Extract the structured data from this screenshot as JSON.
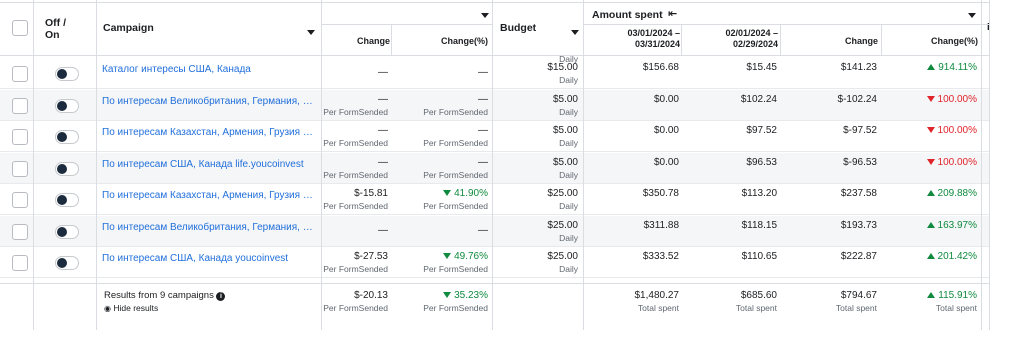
{
  "header": {
    "off_on": "Off /\nOn",
    "off_on_line1": "Off /",
    "off_on_line2": "On",
    "campaign": "Campaign",
    "budget": "Budget",
    "amount_spent": "Amount spent",
    "next_col_clip": "Er",
    "change": "Change",
    "change_pct": "Change(%)",
    "period_current": "03/01/2024 –\n03/31/2024",
    "period_current_l1": "03/01/2024 –",
    "period_current_l2": "03/31/2024",
    "period_prev_l1": "02/01/2024 –",
    "period_prev_l2": "02/29/2024",
    "daily_top": "Daily"
  },
  "rows": [
    {
      "name": "Каталог интересы США, Канада",
      "res_change": "—",
      "res_change_sub": "",
      "res_pct": "—",
      "res_pct_sub": "",
      "res_pct_dir": "",
      "budget": "$15.00",
      "budget_sub": "Daily",
      "spent_cur": "$156.68",
      "spent_prev": "$15.45",
      "spent_change": "$141.23",
      "spent_pct": "914.11%",
      "spent_dir": "up"
    },
    {
      "name": "По интересам Великобритания, Германия, Ис…",
      "res_change": "—",
      "res_change_sub": "Per FormSended",
      "res_pct": "—",
      "res_pct_sub": "Per FormSended",
      "res_pct_dir": "",
      "budget": "$5.00",
      "budget_sub": "Daily",
      "spent_cur": "$0.00",
      "spent_prev": "$102.24",
      "spent_change": "$-102.24",
      "spent_pct": "100.00%",
      "spent_dir": "down"
    },
    {
      "name": "По интересам Казахстан, Армения, Грузия life…",
      "res_change": "—",
      "res_change_sub": "Per FormSended",
      "res_pct": "—",
      "res_pct_sub": "Per FormSended",
      "res_pct_dir": "",
      "budget": "$5.00",
      "budget_sub": "Daily",
      "spent_cur": "$0.00",
      "spent_prev": "$97.52",
      "spent_change": "$-97.52",
      "spent_pct": "100.00%",
      "spent_dir": "down"
    },
    {
      "name": "По интересам США, Канада life.youcoinvest",
      "res_change": "—",
      "res_change_sub": "Per FormSended",
      "res_pct": "—",
      "res_pct_sub": "Per FormSended",
      "res_pct_dir": "",
      "budget": "$5.00",
      "budget_sub": "Daily",
      "spent_cur": "$0.00",
      "spent_prev": "$96.53",
      "spent_change": "$-96.53",
      "spent_pct": "100.00%",
      "spent_dir": "down"
    },
    {
      "name": "По интересам Казахстан, Армения, Грузия you…",
      "res_change": "$-15.81",
      "res_change_sub": "Per FormSended",
      "res_pct": "41.90%",
      "res_pct_sub": "Per FormSended",
      "res_pct_dir": "down",
      "budget": "$25.00",
      "budget_sub": "Daily",
      "spent_cur": "$350.78",
      "spent_prev": "$113.20",
      "spent_change": "$237.58",
      "spent_pct": "209.88%",
      "spent_dir": "up"
    },
    {
      "name": "По интересам Великобритания, Германия, Ис…",
      "res_change": "—",
      "res_change_sub": "",
      "res_pct": "—",
      "res_pct_sub": "",
      "res_pct_dir": "",
      "budget": "$25.00",
      "budget_sub": "Daily",
      "spent_cur": "$311.88",
      "spent_prev": "$118.15",
      "spent_change": "$193.73",
      "spent_pct": "163.97%",
      "spent_dir": "up"
    },
    {
      "name": "По интересам США, Канада youcoinvest",
      "res_change": "$-27.53",
      "res_change_sub": "Per FormSended",
      "res_pct": "49.76%",
      "res_pct_sub": "Per FormSended",
      "res_pct_dir": "down",
      "budget": "$25.00",
      "budget_sub": "Daily",
      "spent_cur": "$333.52",
      "spent_prev": "$110.65",
      "spent_change": "$222.87",
      "spent_pct": "201.42%",
      "spent_dir": "up"
    }
  ],
  "footer": {
    "results": "Results from 9 campaigns",
    "hide": "Hide results",
    "res_change": "$-20.13",
    "res_change_sub": "Per FormSended",
    "res_pct": "35.23%",
    "res_pct_sub": "Per FormSended",
    "spent_cur": "$1,480.27",
    "spent_cur_sub": "Total spent",
    "spent_prev": "$685.60",
    "spent_prev_sub": "Total spent",
    "spent_change": "$794.67",
    "spent_change_sub": "Total spent",
    "spent_pct": "115.91%",
    "spent_pct_sub": "Total spent"
  },
  "colors": {
    "link": "#216fdb",
    "positive": "#0f8a3e",
    "negative": "#e0242b",
    "border": "#dadde1"
  }
}
